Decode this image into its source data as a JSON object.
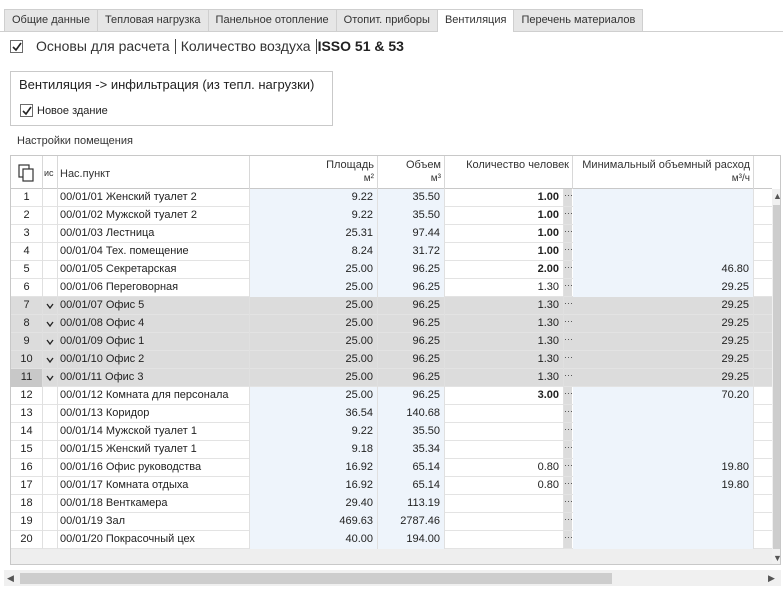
{
  "tabs": [
    "Общие данные",
    "Тепловая нагрузка",
    "Панельное отопление",
    "Отопит. приборы",
    "Вентиляция",
    "Перечень материалов"
  ],
  "active_tab_index": 4,
  "toolbar": {
    "basis_checked": true,
    "basis_label": "Основы для расчета",
    "air_label": "Количество воздуха",
    "standard_label": "ISSO 51 & 53"
  },
  "infiltration_group": {
    "title": "Вентиляция -> инфильтрация (из тепл. нагрузки)",
    "new_building_label": "Новое здание",
    "new_building_checked": true
  },
  "room_settings_label": "Настройки помещения",
  "table": {
    "headers": {
      "check": "ис",
      "name": "Нас.пункт",
      "area": "Площадь",
      "area_unit": "м²",
      "volume": "Объем",
      "volume_unit": "м³",
      "people": "Количество человек",
      "min_flow": "Минимальный объемный расход",
      "min_flow_unit": "м³/ч"
    },
    "rows": [
      {
        "idx": "1",
        "checked": false,
        "name": "00/01/01 Женский туалет 2",
        "area": "9.22",
        "volume": "35.50",
        "people": "1.00",
        "people_bold": true,
        "min_flow": "",
        "selected": false
      },
      {
        "idx": "2",
        "checked": false,
        "name": "00/01/02 Мужской туалет 2",
        "area": "9.22",
        "volume": "35.50",
        "people": "1.00",
        "people_bold": true,
        "min_flow": "",
        "selected": false
      },
      {
        "idx": "3",
        "checked": false,
        "name": "00/01/03 Лестница",
        "area": "25.31",
        "volume": "97.44",
        "people": "1.00",
        "people_bold": true,
        "min_flow": "",
        "selected": false
      },
      {
        "idx": "4",
        "checked": false,
        "name": "00/01/04 Тех. помещение",
        "area": "8.24",
        "volume": "31.72",
        "people": "1.00",
        "people_bold": true,
        "min_flow": "",
        "selected": false
      },
      {
        "idx": "5",
        "checked": false,
        "name": "00/01/05 Секретарская",
        "area": "25.00",
        "volume": "96.25",
        "people": "2.00",
        "people_bold": true,
        "min_flow": "46.80",
        "selected": false
      },
      {
        "idx": "6",
        "checked": false,
        "name": "00/01/06 Переговорная",
        "area": "25.00",
        "volume": "96.25",
        "people": "1.30",
        "people_bold": false,
        "min_flow": "29.25",
        "selected": false
      },
      {
        "idx": "7",
        "checked": true,
        "name": "00/01/07 Офис 5",
        "area": "25.00",
        "volume": "96.25",
        "people": "1.30",
        "people_bold": false,
        "min_flow": "29.25",
        "selected": true
      },
      {
        "idx": "8",
        "checked": true,
        "name": "00/01/08 Офис 4",
        "area": "25.00",
        "volume": "96.25",
        "people": "1.30",
        "people_bold": false,
        "min_flow": "29.25",
        "selected": true
      },
      {
        "idx": "9",
        "checked": true,
        "name": "00/01/09 Офис 1",
        "area": "25.00",
        "volume": "96.25",
        "people": "1.30",
        "people_bold": false,
        "min_flow": "29.25",
        "selected": true
      },
      {
        "idx": "10",
        "checked": true,
        "name": "00/01/10 Офис 2",
        "area": "25.00",
        "volume": "96.25",
        "people": "1.30",
        "people_bold": false,
        "min_flow": "29.25",
        "selected": true
      },
      {
        "idx": "11",
        "checked": true,
        "name": "00/01/11 Офис 3",
        "area": "25.00",
        "volume": "96.25",
        "people": "1.30",
        "people_bold": false,
        "min_flow": "29.25",
        "selected": true,
        "current": true
      },
      {
        "idx": "12",
        "checked": false,
        "name": "00/01/12 Комната для персонала",
        "area": "25.00",
        "volume": "96.25",
        "people": "3.00",
        "people_bold": true,
        "min_flow": "70.20",
        "selected": false
      },
      {
        "idx": "13",
        "checked": false,
        "name": "00/01/13 Коридор",
        "area": "36.54",
        "volume": "140.68",
        "people": "",
        "people_bold": false,
        "min_flow": "",
        "selected": false
      },
      {
        "idx": "14",
        "checked": false,
        "name": "00/01/14 Мужской туалет 1",
        "area": "9.22",
        "volume": "35.50",
        "people": "",
        "people_bold": false,
        "min_flow": "",
        "selected": false
      },
      {
        "idx": "15",
        "checked": false,
        "name": "00/01/15 Женский туалет 1",
        "area": "9.18",
        "volume": "35.34",
        "people": "",
        "people_bold": false,
        "min_flow": "",
        "selected": false
      },
      {
        "idx": "16",
        "checked": false,
        "name": "00/01/16 Офис руководства",
        "area": "16.92",
        "volume": "65.14",
        "people": "0.80",
        "people_bold": false,
        "min_flow": "19.80",
        "selected": false
      },
      {
        "idx": "17",
        "checked": false,
        "name": "00/01/17 Комната отдыха",
        "area": "16.92",
        "volume": "65.14",
        "people": "0.80",
        "people_bold": false,
        "min_flow": "19.80",
        "selected": false
      },
      {
        "idx": "18",
        "checked": false,
        "name": "00/01/18 Венткамера",
        "area": "29.40",
        "volume": "113.19",
        "people": "",
        "people_bold": false,
        "min_flow": "",
        "selected": false
      },
      {
        "idx": "19",
        "checked": false,
        "name": "00/01/19 Зал",
        "area": "469.63",
        "volume": "2787.46",
        "people": "",
        "people_bold": false,
        "min_flow": "",
        "selected": false
      },
      {
        "idx": "20",
        "checked": false,
        "name": "00/01/20 Покрасочный цех",
        "area": "40.00",
        "volume": "194.00",
        "people": "",
        "people_bold": false,
        "min_flow": "",
        "selected": false
      }
    ]
  },
  "colors": {
    "editable_cell": "#eef4fb",
    "selected_row": "#dcdcdc"
  }
}
